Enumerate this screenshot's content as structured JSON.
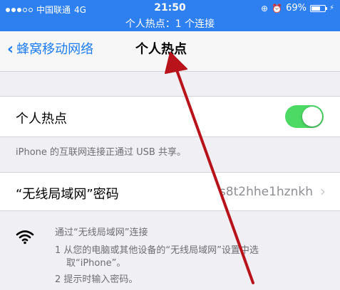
{
  "status_bar": {
    "carrier": "中国联通",
    "network": "4G",
    "time": "21:50",
    "battery": "69%",
    "battery_level": 0.69,
    "hotspot_banner": "个人热点：1 个连接",
    "icons": [
      "signal-dots-icon",
      "rotation-lock-icon",
      "alarm-icon",
      "battery-icon",
      "charging-icon"
    ]
  },
  "nav": {
    "back_label": "蜂窝移动网络",
    "title": "个人热点"
  },
  "hotspot": {
    "label": "个人热点",
    "enabled": true,
    "footnote": "iPhone 的互联网连接正通过 USB 共享。"
  },
  "password": {
    "label": "“无线局域网”密码",
    "value": "s8t2hhe1hznkh"
  },
  "instructions": {
    "title": "通过“无线局域网”连接",
    "step1_line1": "1 从您的电脑或其他设备的“无线局域网”设置中选",
    "step1_line2": "取“iPhone”。",
    "step2": "2 提示时输入密码。"
  },
  "colors": {
    "status_bar_bg": "#2e7ff0",
    "accent_blue": "#1b7cf5",
    "toggle_on": "#4cd964",
    "annotation_arrow": "#b8131a"
  }
}
